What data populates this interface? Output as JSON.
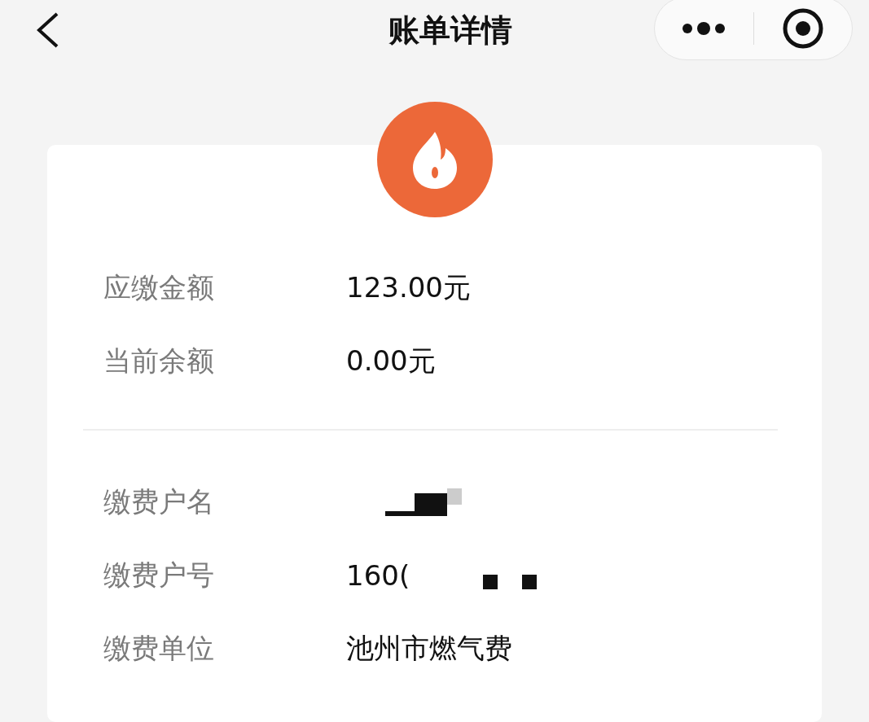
{
  "nav": {
    "title": "账单详情"
  },
  "summary": [
    {
      "label": "应缴金额",
      "value": "123.00元"
    },
    {
      "label": "当前余额",
      "value": "0.00元"
    }
  ],
  "account": [
    {
      "label": "缴费户名",
      "redacted": true
    },
    {
      "label": "缴费户号",
      "value": "160(",
      "redacted": true
    },
    {
      "label": "缴费单位",
      "value": "池州市燃气费",
      "redacted": false
    }
  ]
}
